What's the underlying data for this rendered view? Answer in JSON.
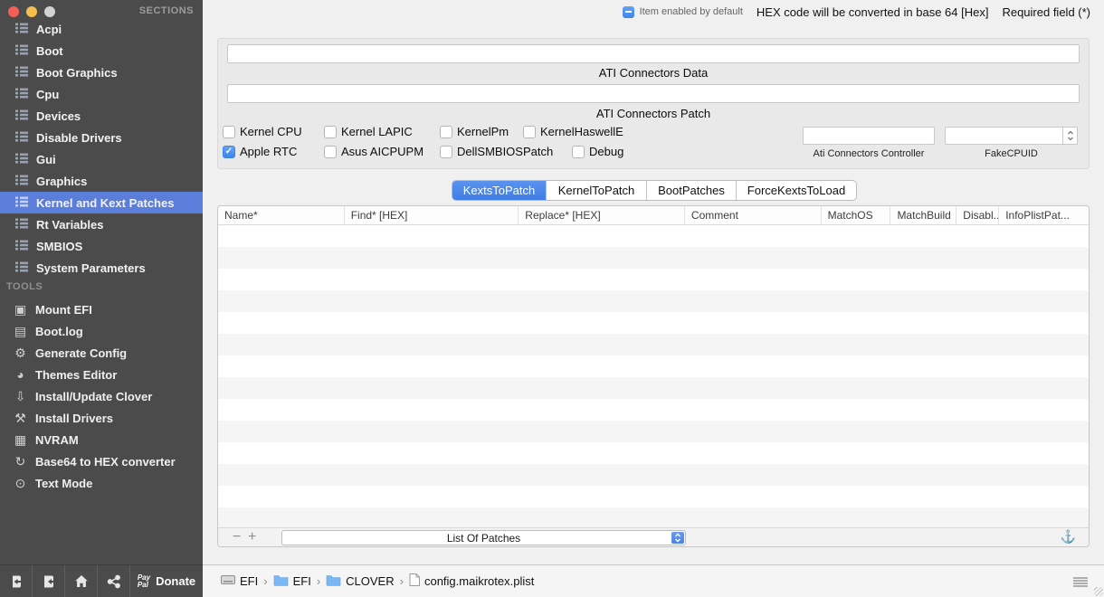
{
  "legend": {
    "item_enabled": "Item enabled by default",
    "hex_note": "HEX code will be converted in base 64 [Hex]",
    "required_note": "Required field (*)"
  },
  "sidebar": {
    "sections_title": "SECTIONS",
    "sections": [
      {
        "label": "Acpi"
      },
      {
        "label": "Boot"
      },
      {
        "label": "Boot Graphics"
      },
      {
        "label": "Cpu"
      },
      {
        "label": "Devices"
      },
      {
        "label": "Disable Drivers"
      },
      {
        "label": "Gui"
      },
      {
        "label": "Graphics"
      },
      {
        "label": "Kernel and Kext Patches",
        "selected": true
      },
      {
        "label": "Rt Variables"
      },
      {
        "label": "SMBIOS"
      },
      {
        "label": "System Parameters"
      }
    ],
    "tools_title": "TOOLS",
    "tools": [
      {
        "label": "Mount EFI",
        "icon": "mount-efi-icon",
        "glyph": "▣"
      },
      {
        "label": "Boot.log",
        "icon": "bootlog-icon",
        "glyph": "▤"
      },
      {
        "label": "Generate Config",
        "icon": "generate-config-icon",
        "glyph": "⚙"
      },
      {
        "label": "Themes Editor",
        "icon": "themes-editor-icon",
        "glyph": "◕"
      },
      {
        "label": "Install/Update Clover",
        "icon": "install-update-clover-icon",
        "glyph": "⇩"
      },
      {
        "label": "Install Drivers",
        "icon": "install-drivers-icon",
        "glyph": "⚒"
      },
      {
        "label": "NVRAM",
        "icon": "nvram-icon",
        "glyph": "▦"
      },
      {
        "label": "Base64 to HEX converter",
        "icon": "base64-to-hex-icon",
        "glyph": "↻"
      },
      {
        "label": "Text Mode",
        "icon": "text-mode-icon",
        "glyph": "⊙"
      }
    ],
    "footer": {
      "paypal_line1": "Pay",
      "paypal_line2": "Pal",
      "donate_label": "Donate"
    }
  },
  "fields": {
    "ati_connectors_data": {
      "label": "ATI Connectors Data",
      "value": ""
    },
    "ati_connectors_patch": {
      "label": "ATI Connectors Patch",
      "value": ""
    },
    "checkbox_rows": [
      [
        {
          "label": "Kernel CPU",
          "checked": false
        },
        {
          "label": "Kernel LAPIC",
          "checked": false
        },
        {
          "label": "KernelPm",
          "checked": false
        },
        {
          "label": "KernelHaswellE",
          "checked": false
        }
      ],
      [
        {
          "label": "Apple RTC",
          "checked": true
        },
        {
          "label": "Asus AICPUPM",
          "checked": false
        },
        {
          "label": "DellSMBIOSPatch",
          "checked": false
        },
        {
          "label": "Debug",
          "checked": false
        }
      ]
    ],
    "ati_connectors_controller": {
      "label": "Ati Connectors Controller",
      "value": ""
    },
    "fakecpuid": {
      "label": "FakeCPUID",
      "value": ""
    }
  },
  "tabs": [
    {
      "label": "KextsToPatch",
      "active": true
    },
    {
      "label": "KernelToPatch",
      "active": false
    },
    {
      "label": "BootPatches",
      "active": false
    },
    {
      "label": "ForceKextsToLoad",
      "active": false
    }
  ],
  "table": {
    "columns": [
      "Name*",
      "Find* [HEX]",
      "Replace* [HEX]",
      "Comment",
      "MatchOS",
      "MatchBuild",
      "Disabl...",
      "InfoPlistPat..."
    ],
    "rows": [],
    "visible_empty_rows": 14
  },
  "list_controls": {
    "remove_label": "−",
    "add_label": "+",
    "dropdown_value": "List Of Patches"
  },
  "statusbar": {
    "separator": "›",
    "path": [
      {
        "label": "EFI",
        "type": "disk"
      },
      {
        "label": "EFI",
        "type": "folder"
      },
      {
        "label": "CLOVER",
        "type": "folder"
      },
      {
        "label": "config.maikrotex.plist",
        "type": "file"
      }
    ]
  },
  "colors": {
    "sidebar_bg": "#4b4b4b",
    "sidebar_selected_blue": "#5b7edb",
    "accent_blue": "#4a87e8",
    "checkbox_blue": "#4a90e8",
    "row_alt": "#f5f5f5"
  }
}
